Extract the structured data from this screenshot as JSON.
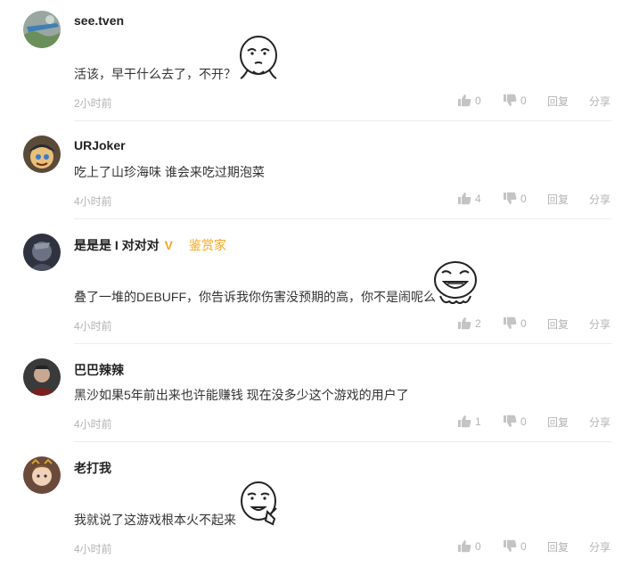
{
  "comments": [
    {
      "user": "see.tven",
      "text": "活该，早干什么去了，不开？",
      "time": "2小时前",
      "likes": "0",
      "dislikes": "0",
      "reply": "回复",
      "share": "分享",
      "emoji": "thinking-meme-face-icon"
    },
    {
      "user": "URJoker",
      "text": "吃上了山珍海味 谁会来吃过期泡菜",
      "time": "4小时前",
      "likes": "4",
      "dislikes": "0",
      "reply": "回复",
      "share": "分享"
    },
    {
      "user": "是是是 I 对对对",
      "verified": "V",
      "badge": "鉴赏家",
      "text": "叠了一堆的DEBUFF，你告诉我你伤害没预期的高，你不是闹呢么",
      "time": "4小时前",
      "likes": "2",
      "dislikes": "0",
      "reply": "回复",
      "share": "分享",
      "emoji": "laughing-meme-face-icon"
    },
    {
      "user": "巴巴辣辣",
      "text": "黑沙如果5年前出来也许能赚钱 现在没多少这个游戏的用户了",
      "time": "4小时前",
      "likes": "1",
      "dislikes": "0",
      "reply": "回复",
      "share": "分享"
    },
    {
      "user": "老打我",
      "text": "我就说了这游戏根本火不起来",
      "time": "4小时前",
      "likes": "0",
      "dislikes": "0",
      "reply": "回复",
      "share": "分享",
      "emoji": "pointing-meme-face-icon"
    }
  ],
  "colors": {
    "badge": "#f5a623",
    "meta": "#b3b3b3",
    "divider": "#ececec"
  }
}
